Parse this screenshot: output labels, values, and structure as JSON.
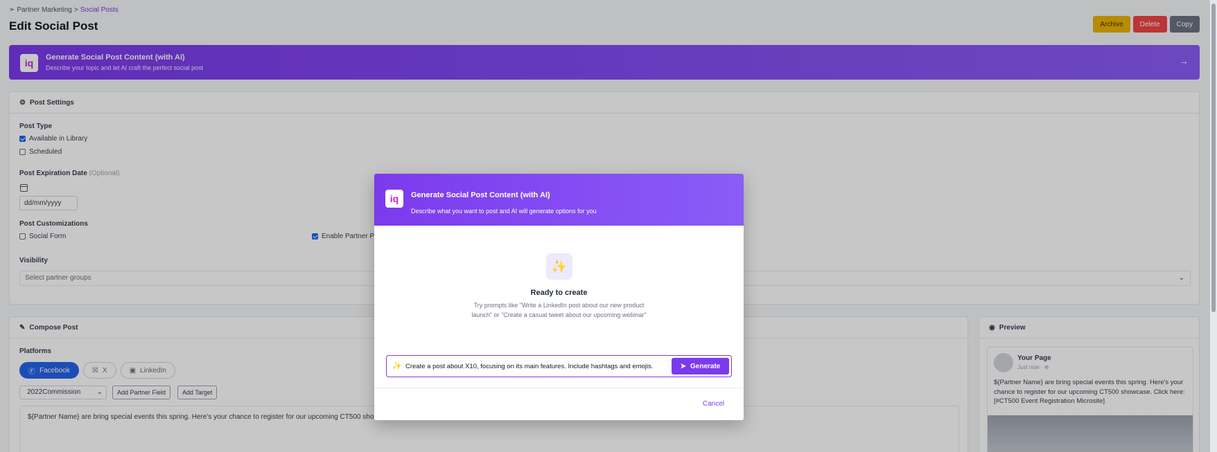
{
  "breadcrumb": {
    "parent": "Partner Marketing",
    "separator": ">",
    "current": "Social Posts"
  },
  "page_title": "Edit Social Post",
  "actions": {
    "archive": "Archive",
    "delete": "Delete",
    "copy": "Copy"
  },
  "ai_banner": {
    "logo": "iq",
    "title": "Generate Social Post Content (with AI)",
    "subtitle": "Describe your topic and let AI craft the perfect social post"
  },
  "settings": {
    "heading": "Post Settings",
    "post_type_label": "Post Type",
    "available_in_library": "Available in Library",
    "scheduled": "Scheduled",
    "expiration_label": "Post Expiration Date",
    "expiration_optional": "(Optional)",
    "date_placeholder": "dd/mm/yyyy",
    "customizations_label": "Post Customizations",
    "social_form": "Social Form",
    "enable_partner": "Enable Partner Pe",
    "visibility_label": "Visibility",
    "visibility_placeholder": "Select partner groups"
  },
  "compose": {
    "heading": "Compose Post",
    "platforms_label": "Platforms",
    "platforms": [
      "Facebook",
      "X",
      "LinkedIn"
    ],
    "field_select": "2022Commission",
    "add_partner_field": "Add Partner Field",
    "add_target": "Add Target",
    "body": "${Partner Name} are bring special events this spring. Here's your chance to register for our upcoming CT500 sho"
  },
  "preview": {
    "heading": "Preview",
    "page_name": "Your Page",
    "time": "Just now · ⊕",
    "text": "${Partner Name} are bring special events this spring. Here's your chance to register for our upcoming CT500 showcase. Click here: [#CT500 Event Registration Microsite]"
  },
  "modal": {
    "logo": "iq",
    "title": "Generate Social Post Content (with AI)",
    "subtitle": "Describe what you want to post and AI will generate options for you",
    "ready": "Ready to create",
    "hint": "Try prompts like \"Write a LinkedIn post about our new product launch\" or \"Create a casual tweet about our upcoming webinar\"",
    "prompt_value": "Create a post about X10, focusing on its main features. Include hashtags and emojis.",
    "generate": "Generate",
    "cancel": "Cancel"
  },
  "colors": {
    "accent": "#7c3aed",
    "primary": "#2563eb",
    "archive": "#eab308",
    "delete": "#ef4444",
    "copy": "#6b7280"
  }
}
